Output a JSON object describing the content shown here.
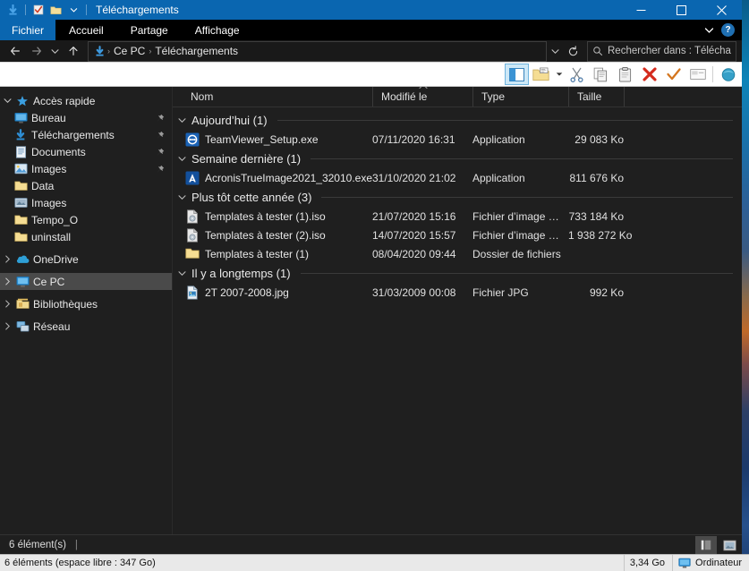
{
  "window": {
    "title": "Téléchargements",
    "quick_access_icons": [
      "download-icon",
      "properties-icon",
      "new-folder-icon",
      "customize-chevron-icon"
    ],
    "controls": {
      "minimize": "minimize-icon",
      "maximize": "maximize-icon",
      "close": "close-icon"
    },
    "accent_color": "#0a66b0"
  },
  "ribbon": {
    "tabs": [
      {
        "label": "Fichier",
        "active": true
      },
      {
        "label": "Accueil",
        "active": false
      },
      {
        "label": "Partage",
        "active": false
      },
      {
        "label": "Affichage",
        "active": false
      }
    ],
    "collapse_icon": "chevron-down-icon",
    "help_label": "?"
  },
  "addressbar": {
    "back_icon": "arrow-left-icon",
    "forward_icon": "arrow-right-icon",
    "recent_icon": "chevron-down-icon",
    "up_icon": "arrow-up-icon",
    "location_icon": "download-icon",
    "breadcrumbs": [
      "Ce PC",
      "Téléchargements"
    ],
    "separator": "›",
    "dropdown_icon": "chevron-down-icon",
    "refresh_icon": "refresh-icon",
    "search_icon": "search-icon",
    "search_placeholder": "Rechercher dans : Télécharg...",
    "search_value": ""
  },
  "commandbar": {
    "buttons": [
      {
        "name": "navigation-pane-toggle",
        "selected": true
      },
      {
        "name": "new-folder-button",
        "selected": false
      },
      {
        "name": "new-folder-dropdown",
        "selected": false
      },
      {
        "name": "cut-button",
        "selected": false
      },
      {
        "name": "copy-button",
        "selected": false
      },
      {
        "name": "paste-button",
        "selected": false
      },
      {
        "name": "delete-button",
        "selected": false
      },
      {
        "name": "select-button",
        "selected": false
      },
      {
        "name": "rename-button",
        "selected": false
      },
      {
        "name": "properties-button",
        "selected": false
      }
    ]
  },
  "sidebar": {
    "items": [
      {
        "label": "Accès rapide",
        "icon": "star-icon",
        "expander": "expanded",
        "level": 0,
        "pinned": false,
        "selected": false
      },
      {
        "label": "Bureau",
        "icon": "desktop-icon",
        "level": 1,
        "pinned": true,
        "selected": false
      },
      {
        "label": "Téléchargements",
        "icon": "download-icon",
        "level": 1,
        "pinned": true,
        "selected": false
      },
      {
        "label": "Documents",
        "icon": "documents-icon",
        "level": 1,
        "pinned": true,
        "selected": false
      },
      {
        "label": "Images",
        "icon": "pictures-icon",
        "level": 1,
        "pinned": true,
        "selected": false
      },
      {
        "label": "Data",
        "icon": "folder-icon",
        "level": 1,
        "pinned": false,
        "selected": false
      },
      {
        "label": "Images",
        "icon": "pictures-folder-icon",
        "level": 1,
        "pinned": false,
        "selected": false
      },
      {
        "label": "Tempo_O",
        "icon": "folder-icon",
        "level": 1,
        "pinned": false,
        "selected": false
      },
      {
        "label": "uninstall",
        "icon": "folder-icon",
        "level": 1,
        "pinned": false,
        "selected": false
      },
      {
        "label": "OneDrive",
        "icon": "onedrive-icon",
        "expander": "collapsed",
        "level": 0,
        "pinned": false,
        "selected": false
      },
      {
        "label": "Ce PC",
        "icon": "this-pc-icon",
        "expander": "collapsed",
        "level": 0,
        "pinned": false,
        "selected": true
      },
      {
        "label": "Bibliothèques",
        "icon": "libraries-icon",
        "expander": "collapsed",
        "level": 0,
        "pinned": false,
        "selected": false
      },
      {
        "label": "Réseau",
        "icon": "network-icon",
        "expander": "collapsed",
        "level": 0,
        "pinned": false,
        "selected": false
      }
    ]
  },
  "filelist": {
    "columns": [
      {
        "label": "Nom",
        "key": "name"
      },
      {
        "label": "Modifié le",
        "key": "modified",
        "sorted": true,
        "sort_icon": "chevron-up-icon"
      },
      {
        "label": "Type",
        "key": "type"
      },
      {
        "label": "Taille",
        "key": "size"
      }
    ],
    "groups": [
      {
        "label": "Aujourd’hui (1)",
        "expander": "chevron-down-icon",
        "rows": [
          {
            "name": "TeamViewer_Setup.exe",
            "modified": "07/11/2020 16:31",
            "type": "Application",
            "size": "29 083 Ko",
            "icon": "teamviewer-icon"
          }
        ]
      },
      {
        "label": "Semaine dernière (1)",
        "expander": "chevron-down-icon",
        "rows": [
          {
            "name": "AcronisTrueImage2021_32010.exe",
            "modified": "31/10/2020 21:02",
            "type": "Application",
            "size": "811 676 Ko",
            "icon": "acronis-icon"
          }
        ]
      },
      {
        "label": "Plus tôt cette année (3)",
        "expander": "chevron-down-icon",
        "rows": [
          {
            "name": "Templates  à tester (1).iso",
            "modified": "21/07/2020 15:16",
            "type": "Fichier d’image di...",
            "size": "733 184 Ko",
            "icon": "disc-image-icon"
          },
          {
            "name": "Templates  à tester (2).iso",
            "modified": "14/07/2020 15:57",
            "type": "Fichier d’image di...",
            "size": "1 938 272 Ko",
            "icon": "disc-image-icon"
          },
          {
            "name": "Templates  à tester (1)",
            "modified": "08/04/2020 09:44",
            "type": "Dossier de fichiers",
            "size": "",
            "icon": "folder-icon"
          }
        ]
      },
      {
        "label": "Il y a longtemps (1)",
        "expander": "chevron-down-icon",
        "rows": [
          {
            "name": "2T 2007-2008.jpg",
            "modified": "31/03/2009 00:08",
            "type": "Fichier JPG",
            "size": "992 Ko",
            "icon": "jpg-icon"
          }
        ]
      }
    ]
  },
  "statusbar": {
    "item_count": "6 élément(s)",
    "separator": "|",
    "details_view_icon": "details-view-icon",
    "large_icons_view_icon": "large-icons-view-icon"
  },
  "taskbar": {
    "left_text": "6 éléments (espace libre : 347 Go)",
    "size_text": "3,34 Go",
    "computer_icon": "computer-icon",
    "computer_text": "Ordinateur"
  }
}
